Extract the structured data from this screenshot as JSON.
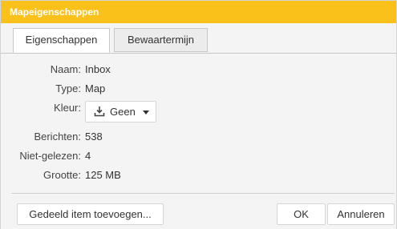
{
  "window": {
    "title": "Mapeigenschappen"
  },
  "tabs": [
    {
      "label": "Eigenschappen",
      "active": true
    },
    {
      "label": "Bewaartermijn",
      "active": false
    }
  ],
  "properties": {
    "name_label": "Naam:",
    "name_value": "Inbox",
    "type_label": "Type:",
    "type_value": "Map",
    "color_label": "Kleur:",
    "color_value": "Geen",
    "messages_label": "Berichten:",
    "messages_value": "538",
    "unread_label": "Niet-gelezen:",
    "unread_value": "4",
    "size_label": "Grootte:",
    "size_value": "125 MB"
  },
  "buttons": {
    "share": "Gedeeld item toevoegen...",
    "ok": "OK",
    "cancel": "Annuleren"
  },
  "colors": {
    "titlebar": "#fbc11b",
    "titlebar_text": "#ffffff"
  },
  "icons": {
    "color_picker": "paint-bucket-icon",
    "dropdown": "caret-down-icon"
  }
}
